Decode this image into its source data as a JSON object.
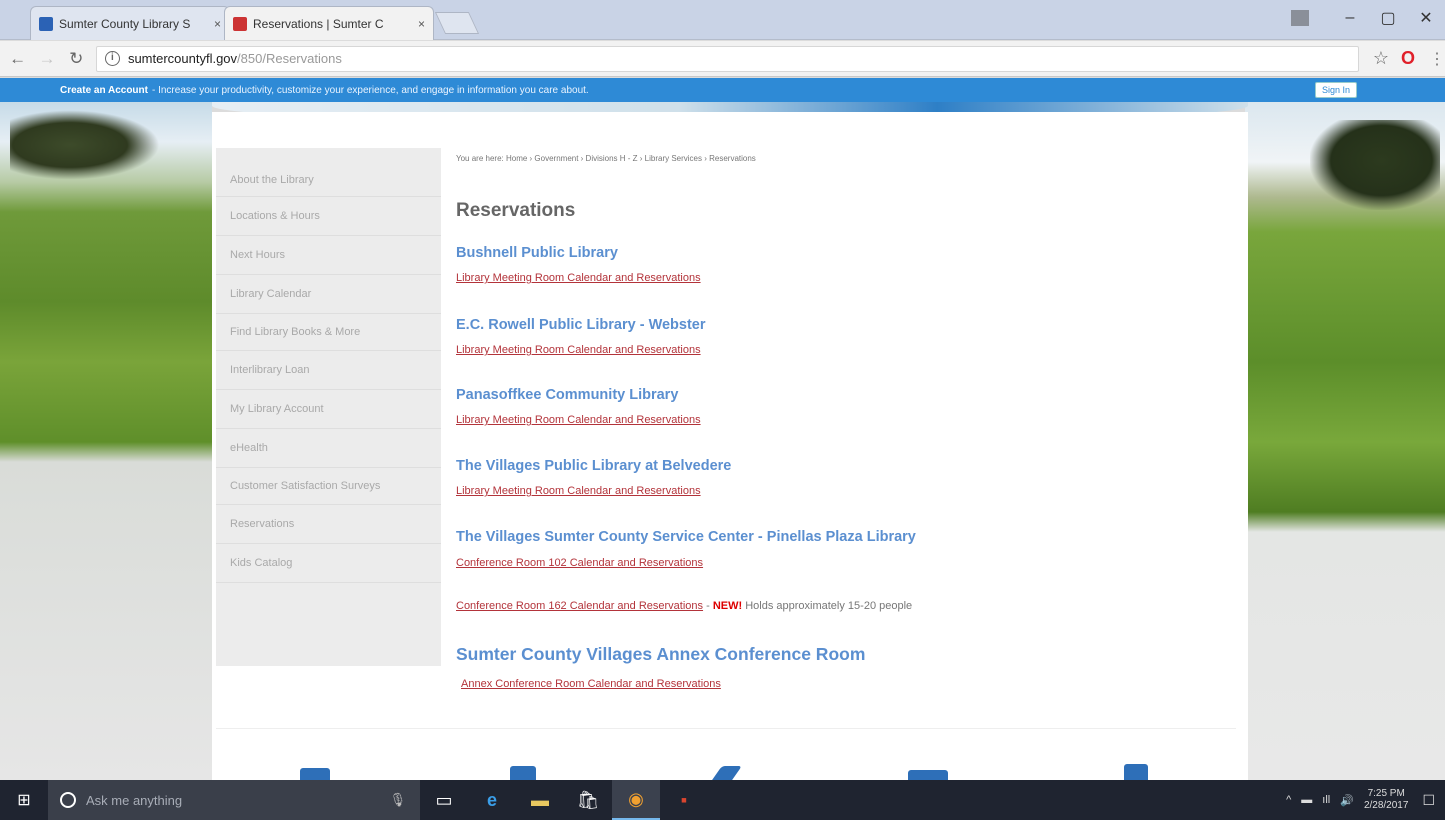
{
  "browser": {
    "tabs": [
      {
        "title": "Sumter County Library S",
        "active": false,
        "favicon": "sumter-favicon"
      },
      {
        "title": "Reservations | Sumter C",
        "active": true,
        "favicon": "sumter-logo-favicon"
      }
    ],
    "close_glyph": "×",
    "window_controls": {
      "user": "",
      "minimize": "–",
      "maximize": "▢",
      "close": "✕"
    },
    "nav": {
      "back": "←",
      "forward": "→",
      "reload": "↻"
    },
    "url_main": "sumtercountyfl.gov",
    "url_path": "/850/Reservations",
    "star": "☆",
    "opera": "O",
    "menu": "⋮"
  },
  "sitebar": {
    "create_account": "Create an Account",
    "message": "- Increase your productivity, customize your experience, and engage in information you care about.",
    "sign_in": "Sign In"
  },
  "sidenav": {
    "items": [
      "About the Library",
      "Locations & Hours",
      "Next Hours",
      "Library Calendar",
      "Find Library Books & More",
      "Interlibrary Loan",
      "My Library Account",
      "eHealth",
      "Customer Satisfaction Surveys",
      "Reservations",
      "Kids Catalog"
    ]
  },
  "main": {
    "breadcrumb": "You are here: Home › Government › Divisions H - Z › Library Services › Reservations",
    "title": "Reservations",
    "libraries": [
      {
        "name": "Bushnell Public Library",
        "link": "Library Meeting Room Calendar and Reservations"
      },
      {
        "name": "E.C. Rowell Public Library - Webster",
        "link": "Library Meeting Room Calendar and Reservations"
      },
      {
        "name": "Panasoffkee Community Library",
        "link": "Library Meeting Room Calendar and Reservations"
      },
      {
        "name": "The Villages Public Library at Belvedere",
        "link": "Library Meeting Room Calendar and Reservations"
      },
      {
        "name": "The Villages Sumter County Service Center - Pinellas Plaza Library",
        "link": "Conference Room 102 Calendar and Reservations"
      }
    ],
    "extra": {
      "link": "Conference Room 162 Calendar and Reservations",
      "dash": " - ",
      "new": "NEW!",
      "note": " Holds approximately 15-20 people"
    },
    "annex": {
      "title": "Sumter County Villages Annex Conference Room",
      "link": "Annex Conference Room Calendar and Reservations"
    }
  },
  "taskbar": {
    "start": "⊞",
    "search_placeholder": "Ask me anything",
    "mic": "🎙",
    "apps": [
      "▭",
      "e",
      "▬",
      "🛍",
      "◉",
      "▪"
    ],
    "tray": {
      "chevron": "^",
      "battery": "▬",
      "network": "ıll",
      "volume": "🔊",
      "time": "7:25 PM",
      "date": "2/28/2017",
      "notifications": "☐"
    }
  }
}
